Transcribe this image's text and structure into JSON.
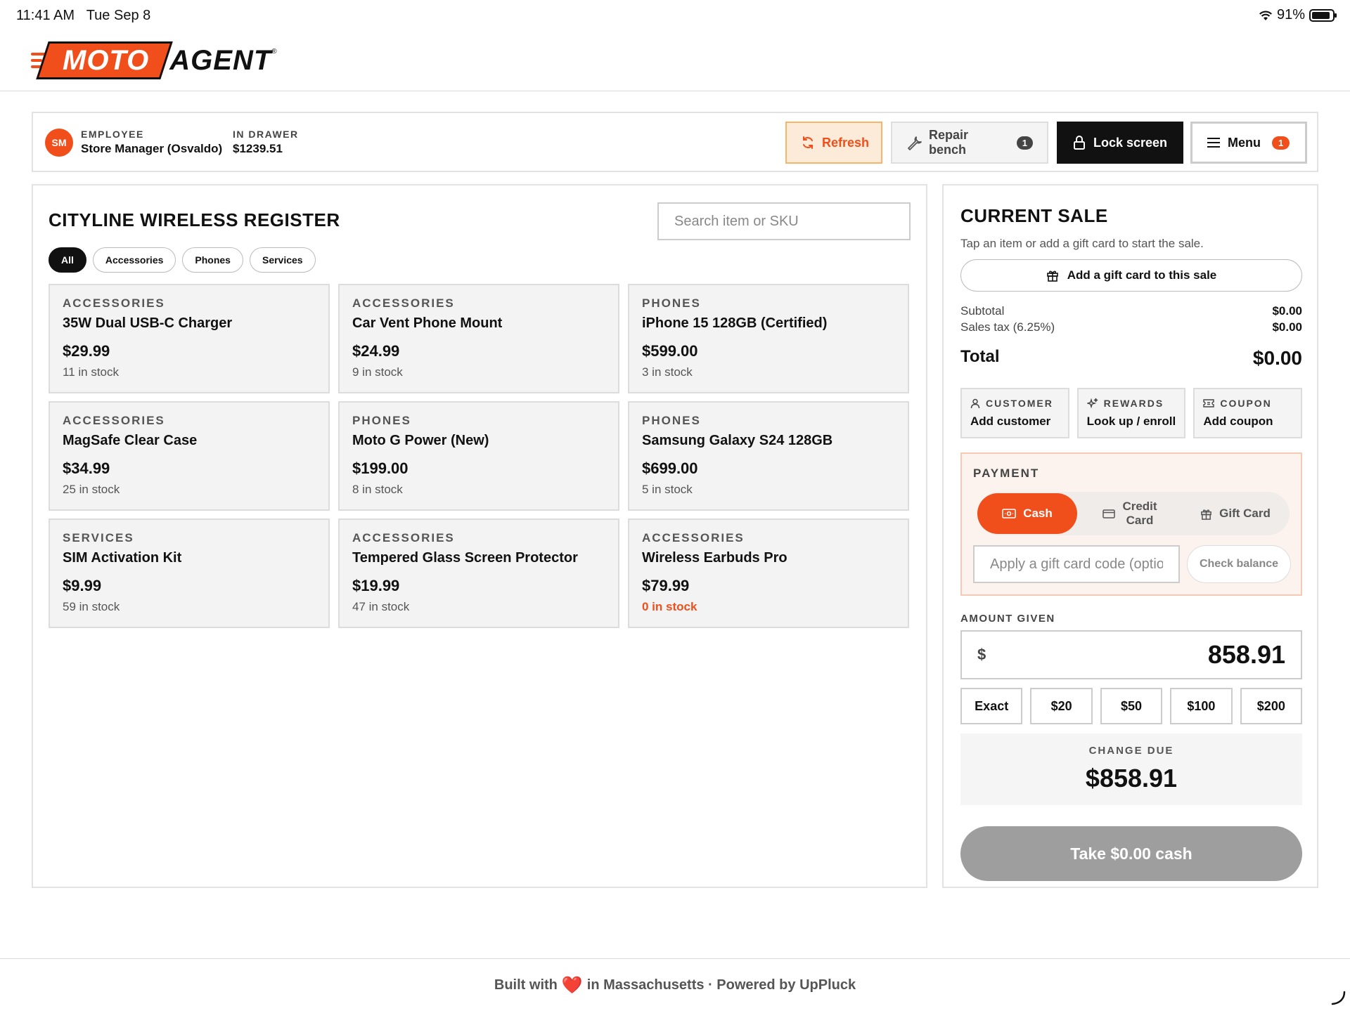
{
  "status_bar": {
    "time": "11:41 AM",
    "date": "Tue Sep 8",
    "battery": "91%"
  },
  "brand": {
    "logo_part1": "MOTO",
    "logo_part2": "AGENT",
    "logo_mark": "®"
  },
  "top_bar": {
    "avatar_initials": "SM",
    "employee_label": "EMPLOYEE",
    "employee_name": "Store Manager (Osvaldo)",
    "drawer_label": "IN DRAWER",
    "drawer_amount": "$1239.51",
    "refresh_label": "Refresh",
    "repair_label": "Repair bench",
    "repair_count": "1",
    "lock_label": "Lock screen",
    "menu_label": "Menu",
    "menu_count": "1"
  },
  "register": {
    "title": "CITYLINE WIRELESS REGISTER",
    "search_placeholder": "Search item or SKU",
    "filters": [
      "All",
      "Accessories",
      "Phones",
      "Services"
    ],
    "active_filter": "All",
    "items": [
      {
        "category": "ACCESSORIES",
        "name": "35W Dual USB-C Charger",
        "price": "$29.99",
        "stock": "11 in stock"
      },
      {
        "category": "ACCESSORIES",
        "name": "Car Vent Phone Mount",
        "price": "$24.99",
        "stock": "9 in stock"
      },
      {
        "category": "PHONES",
        "name": "iPhone 15 128GB (Certified)",
        "price": "$599.00",
        "stock": "3 in stock"
      },
      {
        "category": "ACCESSORIES",
        "name": "MagSafe Clear Case",
        "price": "$34.99",
        "stock": "25 in stock"
      },
      {
        "category": "PHONES",
        "name": "Moto G Power (New)",
        "price": "$199.00",
        "stock": "8 in stock"
      },
      {
        "category": "PHONES",
        "name": "Samsung Galaxy S24 128GB",
        "price": "$699.00",
        "stock": "5 in stock"
      },
      {
        "category": "SERVICES",
        "name": "SIM Activation Kit",
        "price": "$9.99",
        "stock": "59 in stock"
      },
      {
        "category": "ACCESSORIES",
        "name": "Tempered Glass Screen Protector",
        "price": "$19.99",
        "stock": "47 in stock"
      },
      {
        "category": "ACCESSORIES",
        "name": "Wireless Earbuds Pro",
        "price": "$79.99",
        "stock": "0 in stock"
      }
    ]
  },
  "sale": {
    "title": "CURRENT SALE",
    "hint": "Tap an item or add a gift card to start the sale.",
    "gift_button": "Add a gift card to this sale",
    "subtotal_label": "Subtotal",
    "subtotal_value": "$0.00",
    "tax_label": "Sales tax (6.25%)",
    "tax_value": "$0.00",
    "total_label": "Total",
    "total_value": "$0.00",
    "customer_label": "CUSTOMER",
    "customer_action": "Add customer",
    "rewards_label": "REWARDS",
    "rewards_action": "Look up / enroll",
    "coupon_label": "COUPON",
    "coupon_action": "Add coupon",
    "payment_label": "PAYMENT",
    "method_cash": "Cash",
    "method_credit_line1": "Credit",
    "method_credit_line2": "Card",
    "method_gift": "Gift Card",
    "giftcode_placeholder": "Apply a gift card code (optional)",
    "check_balance": "Check balance",
    "amount_given_label": "AMOUNT GIVEN",
    "currency_symbol": "$",
    "amount_given": "858.91",
    "quick_amounts": [
      "Exact",
      "$20",
      "$50",
      "$100",
      "$200"
    ],
    "change_label": "CHANGE DUE",
    "change_value": "$858.91",
    "take_button": "Take $0.00 cash"
  },
  "footer": {
    "part1": "Built with",
    "heart": "❤️",
    "part2": "in Massachusetts · Powered by UpPluck"
  },
  "colors": {
    "accent": "#f04e1a",
    "dark": "#111111",
    "refresh_bg": "#fdebd9",
    "disabled": "#9e9e9e"
  }
}
